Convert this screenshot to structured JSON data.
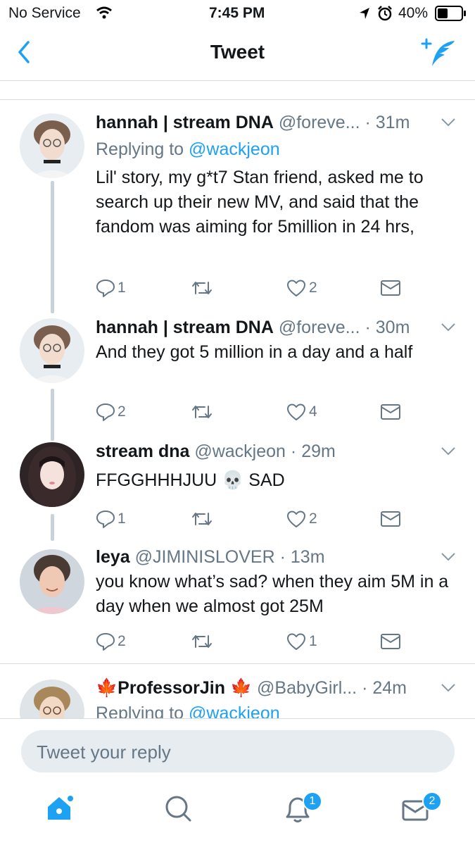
{
  "status_bar": {
    "carrier": "No Service",
    "time": "7:45 PM",
    "battery": "40%"
  },
  "nav": {
    "title": "Tweet"
  },
  "tweets": [
    {
      "name": "hannah | stream DNA",
      "handle": "@foreve...",
      "dot": "·",
      "time": "31m",
      "replying_prefix": "Replying to",
      "replying_to": "@wackjeon",
      "text": "Lil' story, my g*t7 Stan friend, asked me to search up their new MV, and said that the fandom was aiming for 5million in 24 hrs,",
      "replies": "1",
      "retweets": "",
      "likes": "2"
    },
    {
      "name": "hannah | stream DNA",
      "handle": "@foreve...",
      "dot": "·",
      "time": "30m",
      "text": "And they got 5 million in a day and a half",
      "replies": "2",
      "retweets": "",
      "likes": "4"
    },
    {
      "name": "stream dna",
      "handle": "@wackjeon",
      "dot": "·",
      "time": "29m",
      "text_before": "FFGGHHHJUU",
      "emoji": "💀",
      "text_after": "SAD",
      "replies": "1",
      "retweets": "",
      "likes": "2"
    },
    {
      "name": "leya",
      "handle": "@JIMINISLOVER",
      "dot": "·",
      "time": "13m",
      "text": "you know what’s sad? when they aim 5M in a day when we almost got 25M",
      "replies": "2",
      "retweets": "",
      "likes": "1"
    },
    {
      "name_emoji_left": "🍁",
      "name": "ProfessorJin",
      "name_emoji_right": "🍁",
      "handle": "@BabyGirl...",
      "dot": "·",
      "time": "24m",
      "replying_prefix": "Replying to",
      "replying_to": "@wackjeon"
    }
  ],
  "reply_box": {
    "placeholder": "Tweet your reply"
  },
  "tabbar": {
    "notifications_badge": "1",
    "messages_badge": "2"
  },
  "colors": {
    "accent": "#1da1f2",
    "secondary_text": "#657786",
    "divider": "#d8dde2"
  }
}
